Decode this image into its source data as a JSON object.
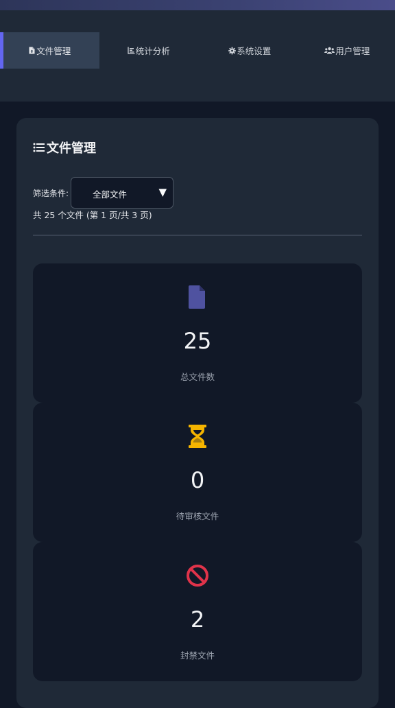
{
  "nav": {
    "items": [
      {
        "label": "文件管理",
        "icon": "file-upload-icon",
        "active": true
      },
      {
        "label": "统计分析",
        "icon": "chart-icon",
        "active": false
      },
      {
        "label": "系统设置",
        "icon": "gear-icon",
        "active": false
      },
      {
        "label": "用户管理",
        "icon": "users-icon",
        "active": false
      }
    ]
  },
  "panel": {
    "title": "文件管理",
    "title_icon": "list-icon",
    "filter_label": "筛选条件:",
    "filter_selected": "全部文件",
    "count_text": "共 25 个文件 (第 1 页/共 3 页)"
  },
  "stats": [
    {
      "value": "25",
      "label": "总文件数",
      "icon": "file-icon",
      "color": "#4f52a0"
    },
    {
      "value": "0",
      "label": "待审核文件",
      "icon": "hourglass-icon",
      "color": "#f5b400"
    },
    {
      "value": "2",
      "label": "封禁文件",
      "icon": "ban-icon",
      "color": "#e0334a"
    }
  ],
  "colors": {
    "accent": "#6366f1",
    "background": "#111827",
    "panel": "#1f2937"
  }
}
